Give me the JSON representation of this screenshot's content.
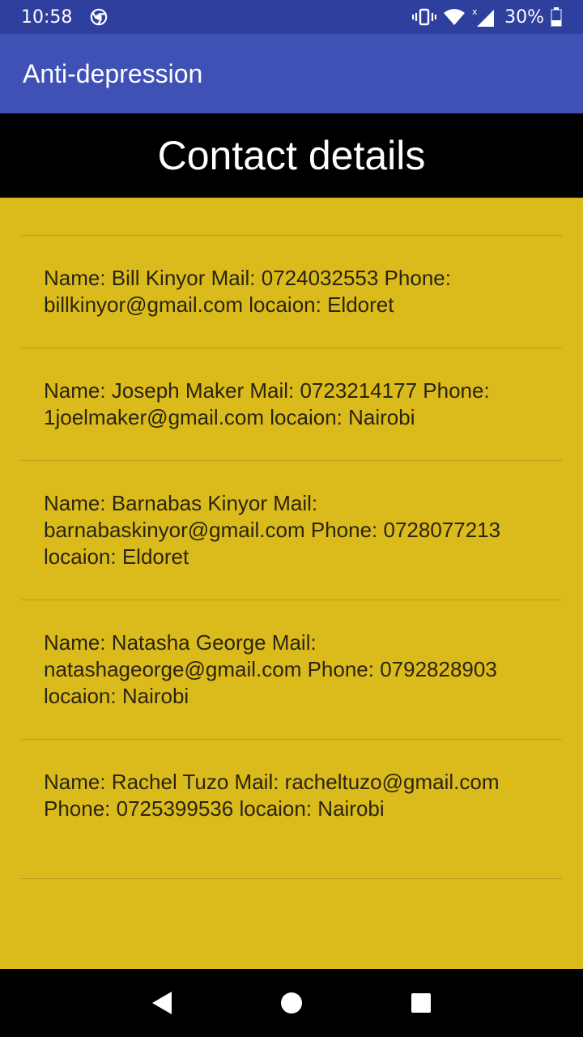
{
  "status_bar": {
    "time": "10:58",
    "battery": "30%",
    "icons": [
      "chrome-icon",
      "vibrate-icon",
      "wifi-icon",
      "signal-icon",
      "battery-icon"
    ]
  },
  "app_bar": {
    "title": "Anti-depression"
  },
  "header": {
    "title": "Contact details"
  },
  "contacts": [
    {
      "text": "Name: Bill Kinyor Mail: 0724032553  Phone: billkinyor@gmail.com  locaion: Eldoret"
    },
    {
      "text": "Name: Joseph Maker  Mail: 0723214177  Phone: 1joelmaker@gmail.com locaion: Nairobi"
    },
    {
      "text": "Name: Barnabas Kinyor  Mail: barnabaskinyor@gmail.com  Phone: 0728077213   locaion: Eldoret"
    },
    {
      "text": "Name: Natasha George  Mail: natashageorge@gmail.com   Phone: 0792828903   locaion: Nairobi"
    },
    {
      "text": "Name: Rachel Tuzo   Mail: racheltuzo@gmail.com  Phone: 0725399536 locaion: Nairobi"
    }
  ],
  "colors": {
    "status_bar": "#2f3f9e",
    "app_bar": "#3f51b5",
    "header": "#000000",
    "content": "#dbbb1c"
  },
  "nav_bar": {
    "icons": [
      "back-icon",
      "home-icon",
      "recents-icon"
    ]
  }
}
